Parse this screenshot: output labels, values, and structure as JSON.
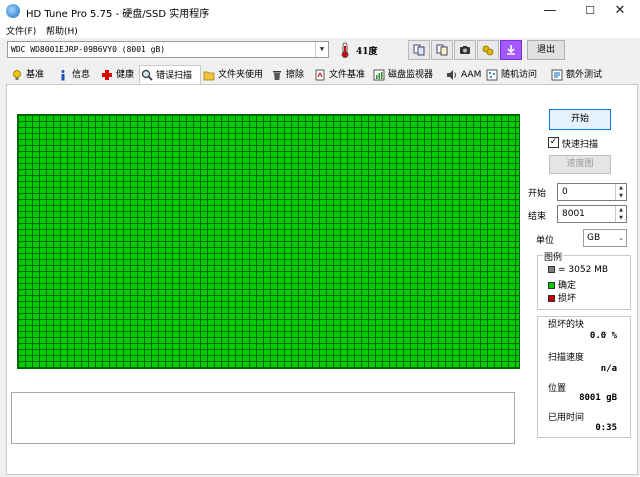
{
  "window": {
    "title": "HD Tune Pro 5.75 - 硬盘/SSD 实用程序",
    "minimize": "—",
    "maximize": "☐",
    "close": "✕"
  },
  "menu": {
    "file": "文件(F)",
    "help": "帮助(H)"
  },
  "toolbar": {
    "drive": "WDC WD8001EJRP-09B6VY0 (8001 gB)",
    "temperature": "41度",
    "exit": "退出",
    "icons": [
      "copy-info-icon",
      "copy-text-icon",
      "screenshot-camera-icon",
      "options-wrench-icon",
      "save-download-icon"
    ]
  },
  "tabs": [
    {
      "label": "基准",
      "icon": "benchmark-bulb-icon"
    },
    {
      "label": "信息",
      "icon": "info-icon"
    },
    {
      "label": "健康",
      "icon": "health-cross-icon"
    },
    {
      "label": "错误扫描",
      "icon": "magnifier-icon",
      "active": true
    },
    {
      "label": "文件夹使用",
      "icon": "folder-icon"
    },
    {
      "label": "擦除",
      "icon": "trash-icon"
    },
    {
      "label": "文件基准",
      "icon": "file-benchmark-icon"
    },
    {
      "label": "磁盘监视器",
      "icon": "disk-monitor-icon"
    },
    {
      "label": "AAM",
      "icon": "speaker-icon"
    },
    {
      "label": "随机访问",
      "icon": "random-access-icon"
    },
    {
      "label": "额外测试",
      "icon": "extra-tests-icon"
    }
  ],
  "controls": {
    "start_button": "开始",
    "quick_scan_label": "快速扫描",
    "quick_scan_checked": true,
    "speed_map_button": "速度图",
    "start_label": "开始",
    "start_value": "0",
    "end_label": "结束",
    "end_value": "8001",
    "unit_label": "单位",
    "unit_value": "GB"
  },
  "legend": {
    "title": "图例",
    "block_size": "= 3052 MB",
    "ok_label": "确定",
    "damaged_label": "损坏",
    "colors": {
      "block": "#808080",
      "ok": "#00cc00",
      "damaged": "#cc0000"
    }
  },
  "stats": {
    "damaged_blocks_label": "损坏的块",
    "damaged_blocks_value": "0.0 %",
    "scan_speed_label": "扫描速度",
    "scan_speed_value": "n/a",
    "position_label": "位置",
    "position_value": "8001 gB",
    "elapsed_label": "已用时间",
    "elapsed_value": "0:35"
  },
  "scan": {
    "progress_fraction": 1.0,
    "status": "all blocks ok"
  }
}
